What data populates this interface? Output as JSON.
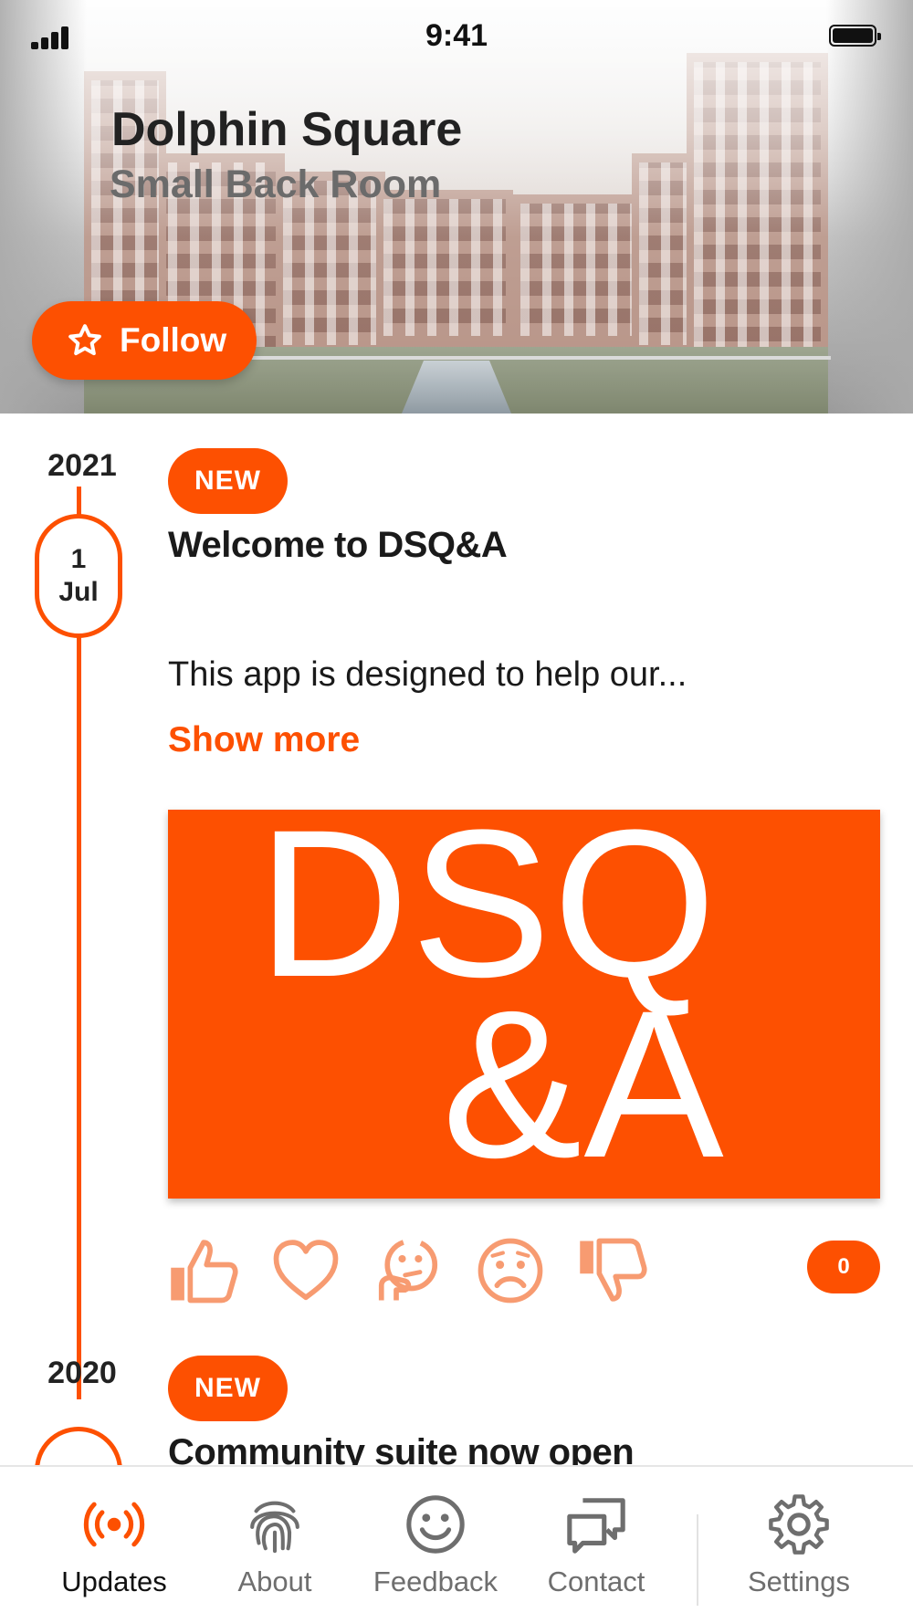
{
  "status_bar": {
    "time": "9:41"
  },
  "header": {
    "title": "Dolphin Square",
    "subtitle": "Small Back Room",
    "follow_label": "Follow"
  },
  "feed": {
    "posts": [
      {
        "year": "2021",
        "day": "1",
        "month": "Jul",
        "badge": "NEW",
        "title": "Welcome to DSQ&A",
        "excerpt": "This app is designed to help our...",
        "show_more": "Show more",
        "image_text_line1": "DSQ",
        "image_text_line2": "&A",
        "reaction_count": "0"
      },
      {
        "year": "2020",
        "badge": "NEW",
        "title": "Community suite now open"
      }
    ]
  },
  "tabs": [
    {
      "label": "Updates",
      "icon": "broadcast-icon",
      "active": true
    },
    {
      "label": "About",
      "icon": "fingerprint-icon",
      "active": false
    },
    {
      "label": "Feedback",
      "icon": "smiley-icon",
      "active": false
    },
    {
      "label": "Contact",
      "icon": "chat-bubbles-icon",
      "active": false
    },
    {
      "label": "Settings",
      "icon": "gear-icon",
      "active": false
    }
  ],
  "colors": {
    "accent": "#fd5001",
    "reaction_icon": "#f79b71",
    "text_primary": "#1a1a1a",
    "tab_inactive": "#6e6e6e"
  }
}
